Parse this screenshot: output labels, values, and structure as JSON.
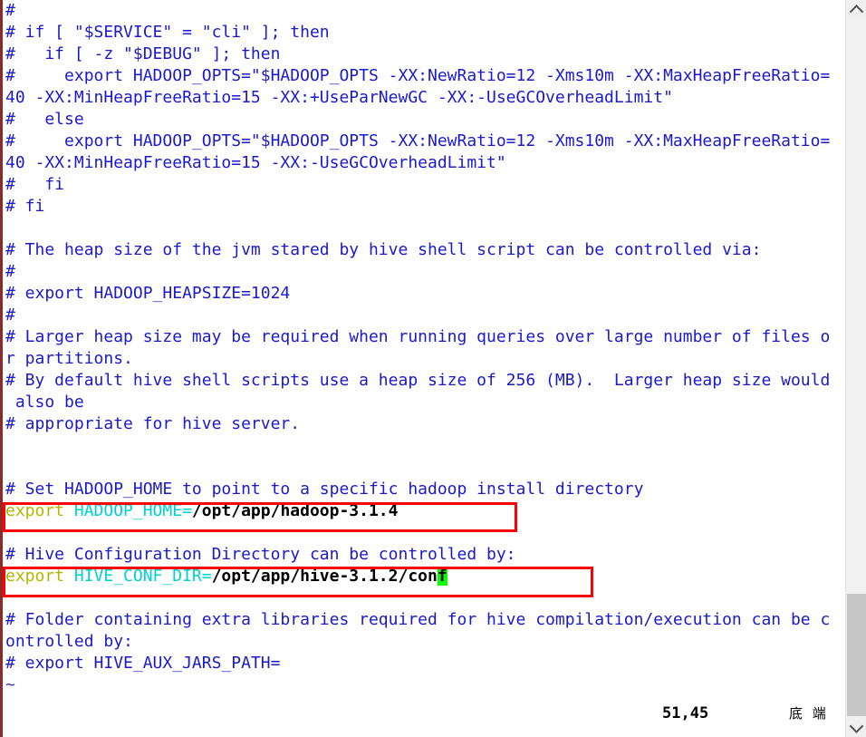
{
  "app": {
    "kind": "terminal-text-editor",
    "colors": {
      "background": "#ffffff",
      "comment_blue": "#1a1acc",
      "keyword_olive": "#b5b500",
      "variable_cyan": "#00d0d0",
      "value_black": "#000000",
      "cursor_green": "#00ff00",
      "annotation_red": "#ff0000",
      "scrollbar_thumb": "#c6c6c6",
      "left_edge": "#8c2b2b"
    }
  },
  "editor": {
    "lines": [
      {
        "id": "l01",
        "segments": [
          {
            "text": "#",
            "style": "cmt"
          }
        ]
      },
      {
        "id": "l02",
        "segments": [
          {
            "text": "# if [ \"$SERVICE\" = \"cli\" ]; then",
            "style": "cmt"
          }
        ]
      },
      {
        "id": "l03",
        "segments": [
          {
            "text": "#   if [ -z \"$DEBUG\" ]; then",
            "style": "cmt"
          }
        ]
      },
      {
        "id": "l04",
        "segments": [
          {
            "text": "#     export HADOOP_OPTS=\"$HADOOP_OPTS -XX:NewRatio=12 -Xms10m -XX:MaxHeapFreeRatio=",
            "style": "cmt"
          }
        ]
      },
      {
        "id": "l05",
        "segments": [
          {
            "text": "40 -XX:MinHeapFreeRatio=15 -XX:+UseParNewGC -XX:-UseGCOverheadLimit\"",
            "style": "cmt"
          }
        ]
      },
      {
        "id": "l06",
        "segments": [
          {
            "text": "#   else",
            "style": "cmt"
          }
        ]
      },
      {
        "id": "l07",
        "segments": [
          {
            "text": "#     export HADOOP_OPTS=\"$HADOOP_OPTS -XX:NewRatio=12 -Xms10m -XX:MaxHeapFreeRatio=",
            "style": "cmt"
          }
        ]
      },
      {
        "id": "l08",
        "segments": [
          {
            "text": "40 -XX:MinHeapFreeRatio=15 -XX:-UseGCOverheadLimit\"",
            "style": "cmt"
          }
        ]
      },
      {
        "id": "l09",
        "segments": [
          {
            "text": "#   fi",
            "style": "cmt"
          }
        ]
      },
      {
        "id": "l10",
        "segments": [
          {
            "text": "# fi",
            "style": "cmt"
          }
        ]
      },
      {
        "id": "l11",
        "segments": [
          {
            "text": " ",
            "style": "blank"
          }
        ]
      },
      {
        "id": "l12",
        "segments": [
          {
            "text": "# The heap size of the jvm stared by hive shell script can be controlled via:",
            "style": "cmt"
          }
        ]
      },
      {
        "id": "l13",
        "segments": [
          {
            "text": "#",
            "style": "cmt"
          }
        ]
      },
      {
        "id": "l14",
        "segments": [
          {
            "text": "# export HADOOP_HEAPSIZE=1024",
            "style": "cmt"
          }
        ]
      },
      {
        "id": "l15",
        "segments": [
          {
            "text": "#",
            "style": "cmt"
          }
        ]
      },
      {
        "id": "l16",
        "segments": [
          {
            "text": "# Larger heap size may be required when running queries over large number of files o",
            "style": "cmt"
          }
        ]
      },
      {
        "id": "l17",
        "segments": [
          {
            "text": "r partitions.",
            "style": "cmt"
          }
        ]
      },
      {
        "id": "l18",
        "segments": [
          {
            "text": "# By default hive shell scripts use a heap size of 256 (MB).  Larger heap size would",
            "style": "cmt"
          }
        ]
      },
      {
        "id": "l19",
        "segments": [
          {
            "text": " also be",
            "style": "cmt"
          }
        ]
      },
      {
        "id": "l20",
        "segments": [
          {
            "text": "# appropriate for hive server.",
            "style": "cmt"
          }
        ]
      },
      {
        "id": "l21",
        "segments": [
          {
            "text": " ",
            "style": "blank"
          }
        ]
      },
      {
        "id": "l22",
        "segments": [
          {
            "text": " ",
            "style": "blank"
          }
        ]
      },
      {
        "id": "l23",
        "segments": [
          {
            "text": "# Set HADOOP_HOME to point to a specific hadoop install directory",
            "style": "cmt"
          }
        ]
      },
      {
        "id": "l24",
        "segments": [
          {
            "text": "export ",
            "style": "kw"
          },
          {
            "text": "HADOOP_HOME=",
            "style": "var"
          },
          {
            "text": "/opt/app/hadoop-3.1.4",
            "style": "val"
          }
        ]
      },
      {
        "id": "l25",
        "segments": [
          {
            "text": " ",
            "style": "blank"
          }
        ]
      },
      {
        "id": "l26",
        "segments": [
          {
            "text": "# Hive Configuration Directory can be controlled by:",
            "style": "cmt"
          }
        ]
      },
      {
        "id": "l27",
        "segments": [
          {
            "text": "export ",
            "style": "kw"
          },
          {
            "text": "HIVE_CONF_DIR=",
            "style": "var"
          },
          {
            "text": "/opt/app/hive-3.1.2/con",
            "style": "val"
          },
          {
            "text": "f",
            "style": "cursor"
          }
        ]
      },
      {
        "id": "l28",
        "segments": [
          {
            "text": " ",
            "style": "blank"
          }
        ]
      },
      {
        "id": "l29",
        "segments": [
          {
            "text": "# Folder containing extra libraries required for hive compilation/execution can be c",
            "style": "cmt"
          }
        ]
      },
      {
        "id": "l30",
        "segments": [
          {
            "text": "ontrolled by:",
            "style": "cmt"
          }
        ]
      },
      {
        "id": "l31",
        "segments": [
          {
            "text": "# export HIVE_AUX_JARS_PATH=",
            "style": "cmt"
          }
        ]
      },
      {
        "id": "l32",
        "segments": [
          {
            "text": "~",
            "style": "tilde"
          }
        ]
      }
    ]
  },
  "annotations": [
    {
      "id": "redbox-1",
      "label": "hadoop-home-highlight-box"
    },
    {
      "id": "redbox-2",
      "label": "hive-conf-dir-highlight-box"
    }
  ],
  "statusbar": {
    "cursor_position": "51,45",
    "file_position": "底 端"
  },
  "scrollbar": {
    "up_arrow": "▲",
    "down_arrow": "▼"
  }
}
